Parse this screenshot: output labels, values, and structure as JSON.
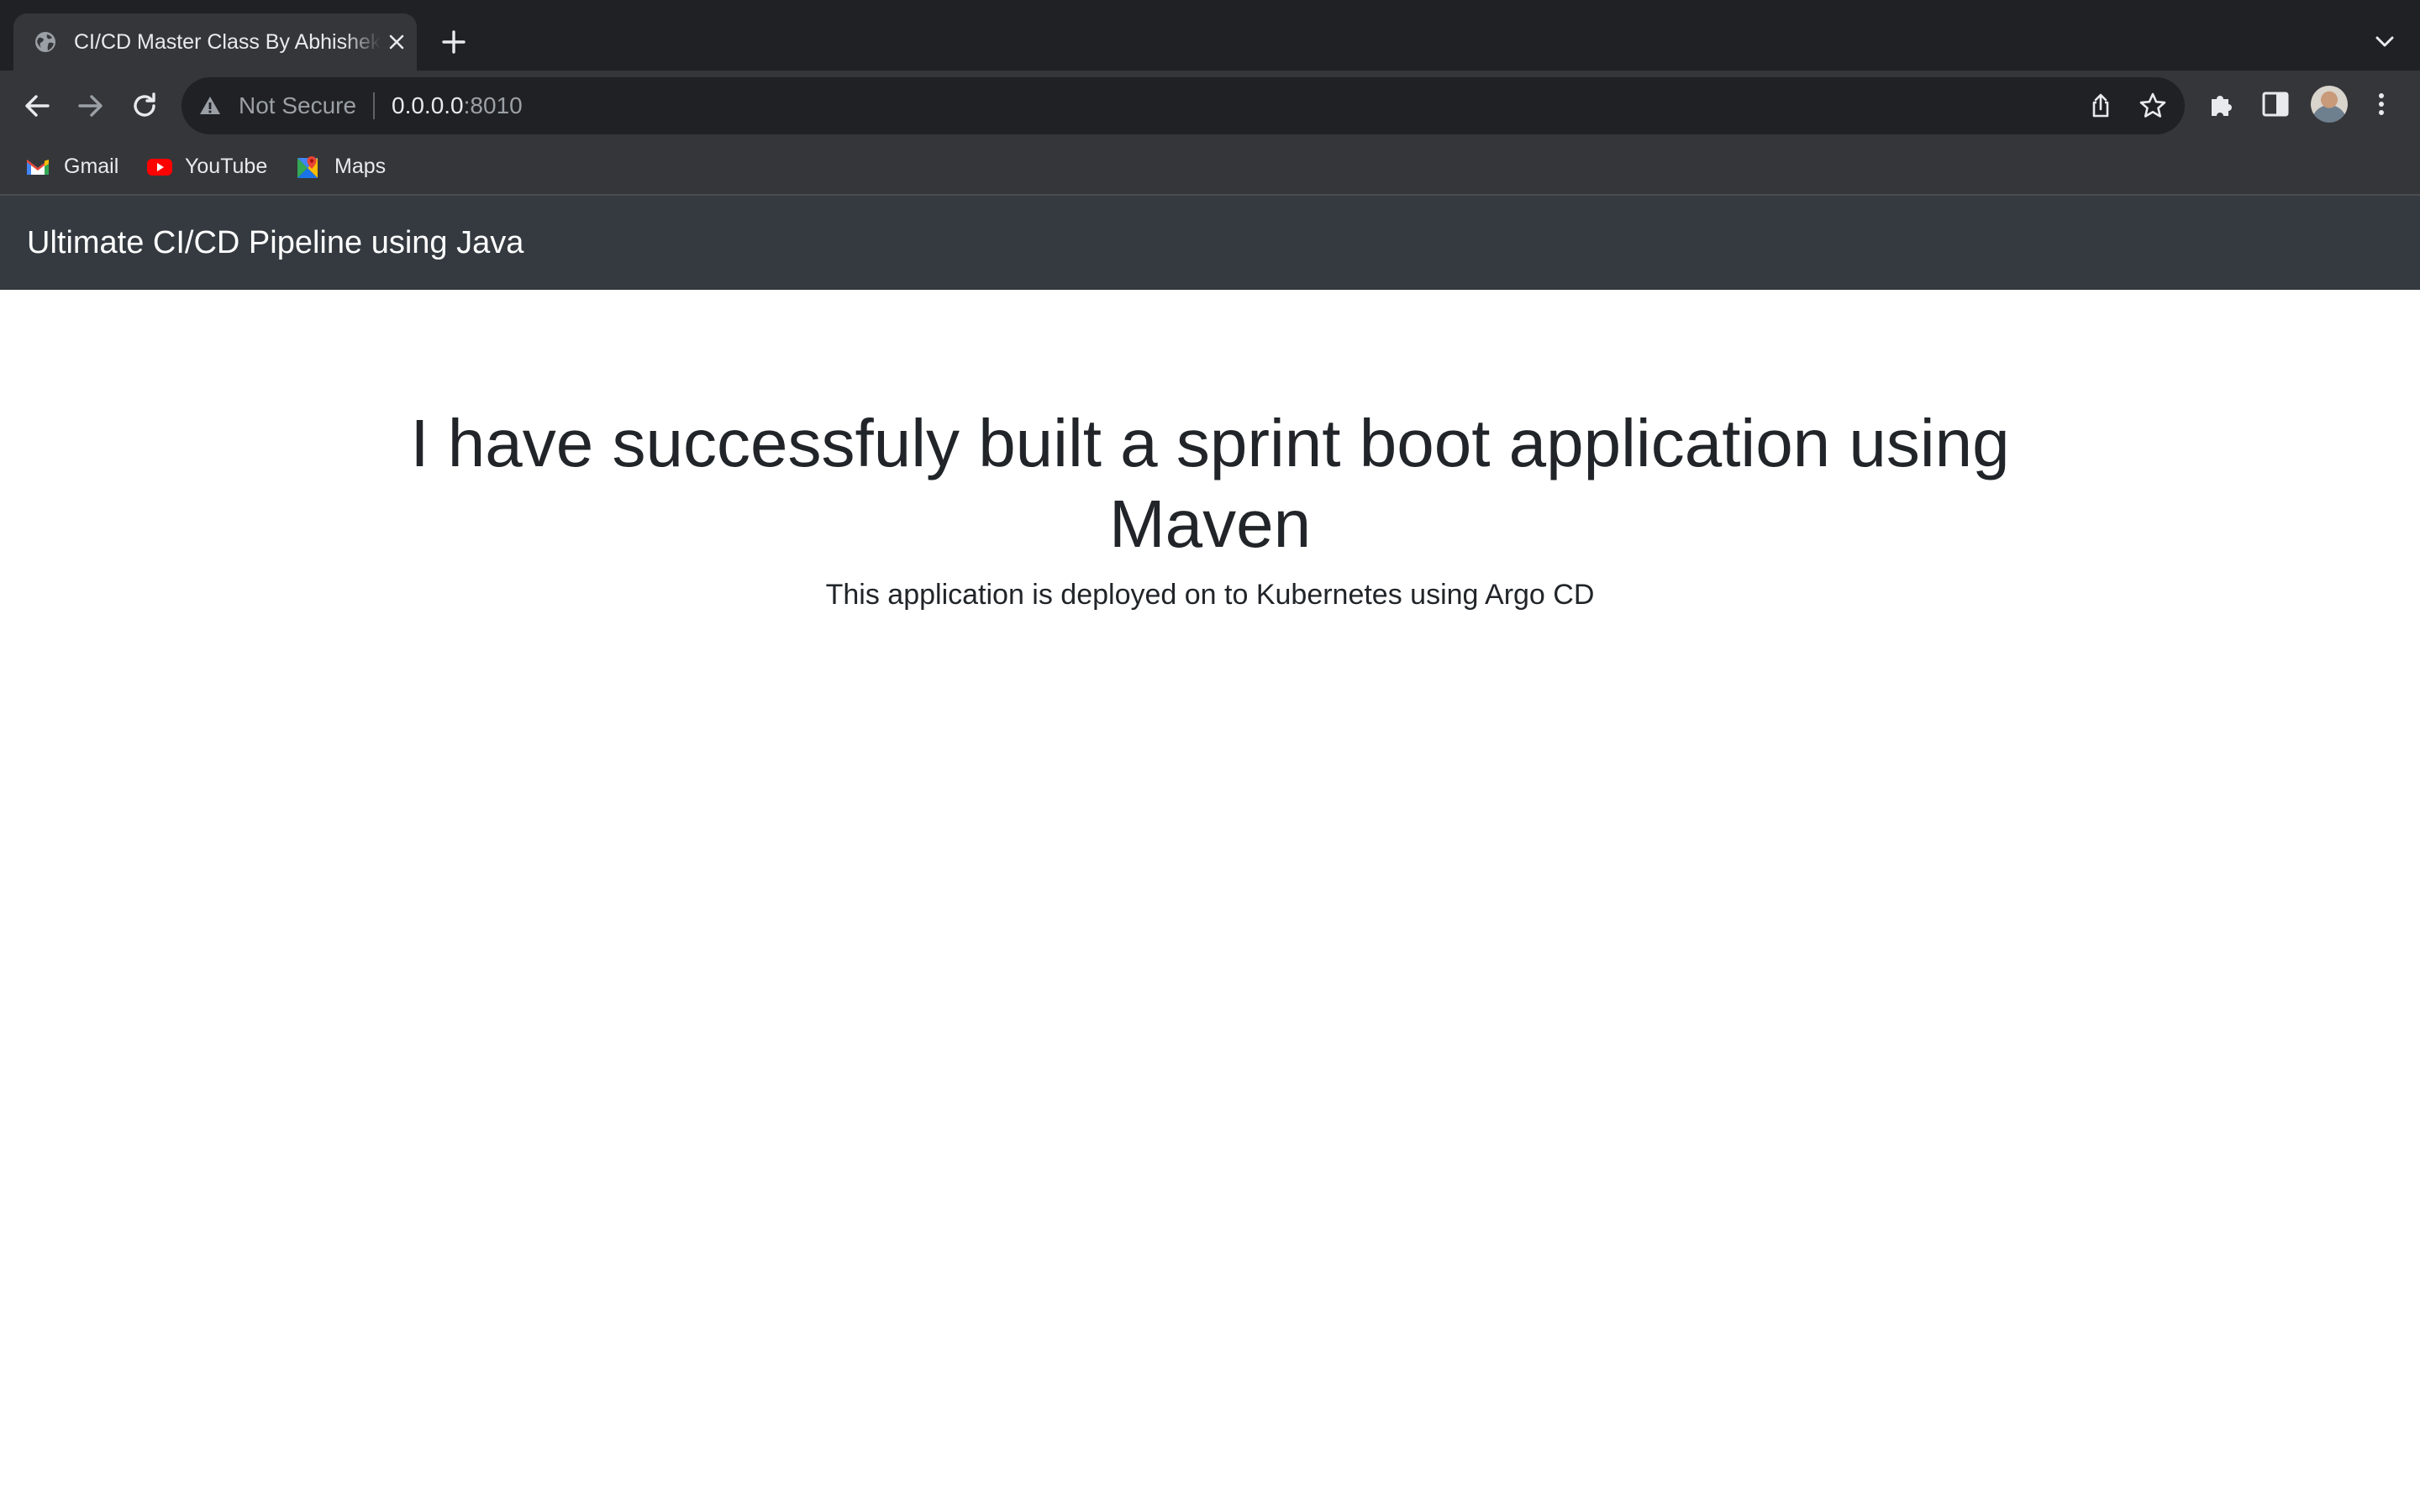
{
  "browser": {
    "tab": {
      "title": "CI/CD Master Class By Abhishek Veeramalla"
    },
    "address_bar": {
      "security_label": "Not Secure",
      "url_host": "0.0.0.0",
      "url_port": ":8010"
    },
    "bookmarks": [
      {
        "label": "Gmail",
        "icon": "gmail-icon"
      },
      {
        "label": "YouTube",
        "icon": "youtube-icon"
      },
      {
        "label": "Maps",
        "icon": "maps-icon"
      }
    ]
  },
  "page": {
    "navbar": {
      "brand": "Ultimate CI/CD Pipeline using Java"
    },
    "heading": "I have successfuly built a sprint boot application using Maven",
    "subtext": "This application is deployed on to Kubernetes using Argo CD"
  }
}
